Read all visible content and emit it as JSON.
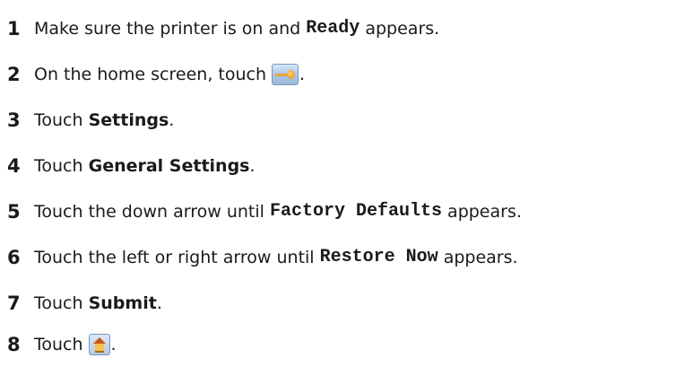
{
  "steps": [
    {
      "number": "1",
      "before": "Make sure the printer is on and",
      "code": "Ready",
      "after": "appears."
    },
    {
      "number": "2",
      "before": "On the home screen, touch",
      "icon": "menu-key-icon",
      "after": "."
    },
    {
      "number": "3",
      "before": "Touch",
      "bold": "Settings",
      "after": "."
    },
    {
      "number": "4",
      "before": "Touch",
      "bold": "General Settings",
      "after": "."
    },
    {
      "number": "5",
      "before": "Touch the down arrow until",
      "code": "Factory Defaults",
      "after": "appears."
    },
    {
      "number": "6",
      "before": "Touch the left or right arrow until",
      "code": "Restore Now",
      "after": "appears."
    },
    {
      "number": "7",
      "before": "Touch",
      "bold": "Submit",
      "after": "."
    },
    {
      "number": "8",
      "before": "Touch",
      "icon": "home-icon",
      "after": "."
    }
  ]
}
